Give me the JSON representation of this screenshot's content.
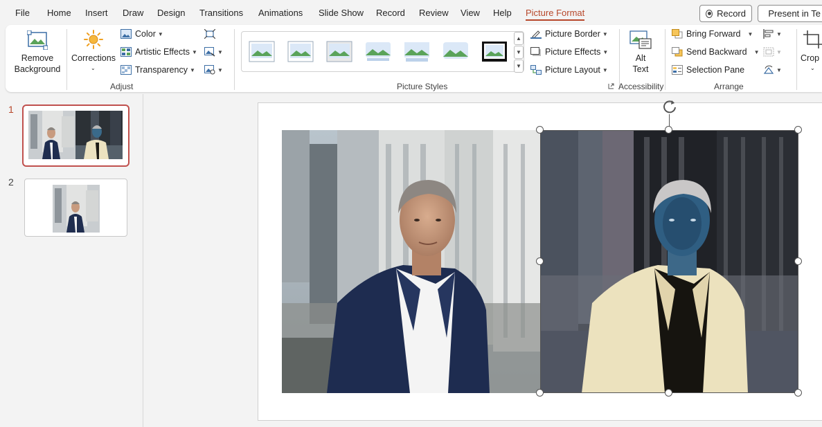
{
  "menu": {
    "items": [
      "File",
      "Home",
      "Insert",
      "Draw",
      "Design",
      "Transitions",
      "Animations",
      "Slide Show",
      "Record",
      "Review",
      "View",
      "Help",
      "Picture Format"
    ],
    "active": "Picture Format",
    "record_label": "Record",
    "present_label": "Present in Te"
  },
  "ribbon": {
    "adjust": {
      "remove_background": [
        "Remove",
        "Background"
      ],
      "corrections": "Corrections",
      "color": "Color",
      "artistic_effects": "Artistic Effects",
      "transparency": "Transparency",
      "group_label": "Adjust"
    },
    "picture_styles": {
      "group_label": "Picture Styles",
      "picture_border": "Picture Border",
      "picture_effects": "Picture Effects",
      "picture_layout": "Picture Layout"
    },
    "accessibility": {
      "alt_text": [
        "Alt",
        "Text"
      ],
      "group_label": "Accessibility"
    },
    "arrange": {
      "bring_forward": "Bring Forward",
      "send_backward": "Send Backward",
      "selection_pane": "Selection Pane",
      "group_label": "Arrange"
    },
    "size": {
      "crop": "Crop"
    }
  },
  "slides": [
    {
      "number": "1",
      "selected": true
    },
    {
      "number": "2",
      "selected": false
    }
  ],
  "colors": {
    "accent": "#b7472a",
    "selection_border": "#c0504d"
  }
}
